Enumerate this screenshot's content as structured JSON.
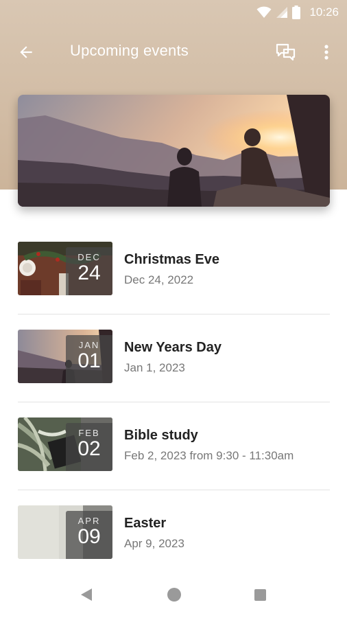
{
  "status_bar": {
    "time": "10:26",
    "icons": [
      "wifi-icon",
      "signal-icon",
      "battery-icon"
    ]
  },
  "app_bar": {
    "title": "Upcoming events",
    "icons": [
      "back-arrow-icon",
      "chat-icon",
      "more-vert-icon"
    ]
  },
  "hero": {
    "image": "people watching sunset over mountains"
  },
  "events": [
    {
      "month": "DEC",
      "day": "24",
      "title": "Christmas Eve",
      "subtitle": "Dec 24, 2022",
      "thumb": "holiday table"
    },
    {
      "month": "JAN",
      "day": "01",
      "title": "New Years Day",
      "subtitle": "Jan 1, 2023",
      "thumb": "sunset silhouettes"
    },
    {
      "month": "FEB",
      "day": "02",
      "title": "Bible study",
      "subtitle": "Feb 2, 2023 from 9:30 - 11:30am",
      "thumb": "bible and plant"
    },
    {
      "month": "APR",
      "day": "09",
      "title": "Easter",
      "subtitle": "Apr 9, 2023",
      "thumb": "light stone"
    }
  ],
  "nav_bar": {
    "icons": [
      "nav-back-icon",
      "nav-home-icon",
      "nav-recents-icon"
    ]
  },
  "colors": {
    "header": "#d2bda6",
    "title_text": "#ffffff",
    "item_title": "#222222",
    "item_subtitle": "#777777"
  }
}
